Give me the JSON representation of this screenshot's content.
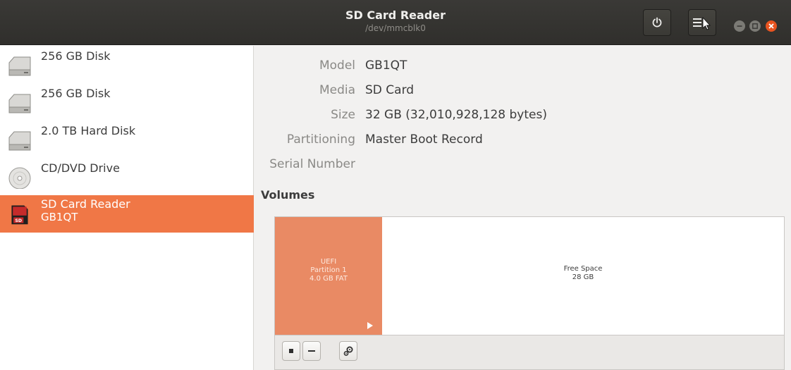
{
  "window": {
    "title": "SD Card Reader",
    "subtitle": "/dev/mmcblk0",
    "buttons": {
      "power_icon": "power-icon",
      "menu_icon": "hamburger-menu-icon"
    },
    "controls": [
      "minimize",
      "maximize",
      "close"
    ]
  },
  "sidebar": {
    "drives": [
      {
        "label": "256 GB Disk",
        "icon": "hard-disk-icon"
      },
      {
        "label": "256 GB Disk",
        "icon": "hard-disk-icon"
      },
      {
        "label": "2.0 TB Hard Disk",
        "icon": "hard-disk-icon"
      },
      {
        "label": "CD/DVD Drive",
        "icon": "optical-disc-icon"
      },
      {
        "label": "SD Card Reader",
        "sublabel": "GB1QT",
        "icon": "sd-card-icon",
        "selected": true
      }
    ]
  },
  "details": {
    "rows": [
      {
        "key": "Model",
        "value": "GB1QT"
      },
      {
        "key": "Media",
        "value": "SD Card"
      },
      {
        "key": "Size",
        "value": "32 GB (32,010,928,128 bytes)"
      },
      {
        "key": "Partitioning",
        "value": "Master Boot Record"
      },
      {
        "key": "Serial Number",
        "value": ""
      }
    ],
    "volumes_heading": "Volumes"
  },
  "volumes": {
    "partitions": [
      {
        "line1": "UEFI",
        "line2": "Partition 1",
        "line3": "4.0 GB FAT"
      },
      {
        "line1": "Free Space",
        "line2": "28 GB"
      }
    ],
    "toolbar": [
      "stop-icon",
      "minus-icon",
      "gears-icon"
    ]
  },
  "colors": {
    "accent": "#f07746",
    "partition_fill": "#e98a64",
    "headerbar": "#33322f",
    "close_button": "#e95420"
  }
}
